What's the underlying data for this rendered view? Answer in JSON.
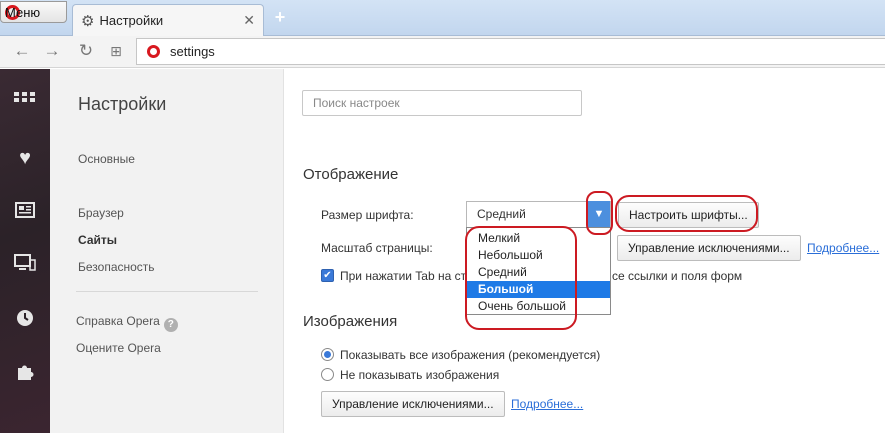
{
  "browser": {
    "menu_label": "Меню",
    "tab_title": "Настройки",
    "tab_close": "✕",
    "new_tab": "+",
    "address": "settings",
    "accent_red": "#d8181f"
  },
  "sidebar_icons": [
    "speed-dial-icon",
    "heart-icon",
    "news-icon",
    "devices-icon",
    "history-icon",
    "extensions-icon"
  ],
  "settings_nav": {
    "heading": "Настройки",
    "items": [
      "Основные",
      "Браузер",
      "Сайты",
      "Безопасность"
    ],
    "active": "Сайты",
    "help": "Справка Opera",
    "rate": "Оцените Opera"
  },
  "main": {
    "search_placeholder": "Поиск настроек",
    "display": {
      "title": "Отображение",
      "font_size_label": "Размер шрифта:",
      "font_size_value": "Средний",
      "customize_fonts": "Настроить шрифты...",
      "page_zoom_label": "Масштаб страницы:",
      "manage_exceptions": "Управление исключениями...",
      "more": "Подробнее...",
      "tab_checkbox_left": "При нажатии Tab на ст",
      "tab_checkbox_right": "се ссылки и поля форм",
      "font_options": [
        "Мелкий",
        "Небольшой",
        "Средний",
        "Большой",
        "Очень большой"
      ],
      "highlighted_option": "Большой"
    },
    "images": {
      "title": "Изображения",
      "show_all": "Показывать все изображения (рекомендуется)",
      "hide_all": "Не показывать изображения",
      "manage_exceptions": "Управление исключениями...",
      "more": "Подробнее..."
    }
  },
  "colors": {
    "select_arrow": "#4c8fde",
    "highlight": "#1e7ae6",
    "annotation": "#cc1a22",
    "link": "#2a6ed8"
  }
}
